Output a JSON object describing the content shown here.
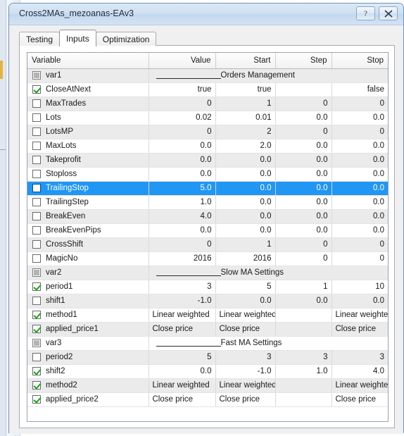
{
  "window": {
    "title": "Cross2MAs_mezoanas-EAv3",
    "help_button": "?",
    "close_button": "✕"
  },
  "tabs": [
    {
      "label": "Testing",
      "active": false
    },
    {
      "label": "Inputs",
      "active": true
    },
    {
      "label": "Optimization",
      "active": false
    }
  ],
  "grid": {
    "columns": [
      "Variable",
      "Value",
      "Start",
      "Step",
      "Stop"
    ],
    "rows": [
      {
        "type": "separator",
        "variable": "var1",
        "checkbox": "gray",
        "label": "Orders Management",
        "shade": "alt"
      },
      {
        "type": "data",
        "variable": "CloseAtNext",
        "checkbox": "checked",
        "value": "true",
        "start": "true",
        "step": "",
        "stop": "false",
        "shade": "norm"
      },
      {
        "type": "data",
        "variable": "MaxTrades",
        "checkbox": "unchecked",
        "value": "0",
        "start": "1",
        "step": "0",
        "stop": "0",
        "shade": "alt"
      },
      {
        "type": "data",
        "variable": "Lots",
        "checkbox": "unchecked",
        "value": "0.02",
        "start": "0.01",
        "step": "0.0",
        "stop": "0.0",
        "shade": "norm"
      },
      {
        "type": "data",
        "variable": "LotsMP",
        "checkbox": "unchecked",
        "value": "0",
        "start": "2",
        "step": "0",
        "stop": "0",
        "shade": "alt"
      },
      {
        "type": "data",
        "variable": "MaxLots",
        "checkbox": "unchecked",
        "value": "0.0",
        "start": "2.0",
        "step": "0.0",
        "stop": "0.0",
        "shade": "norm"
      },
      {
        "type": "data",
        "variable": "Takeprofit",
        "checkbox": "unchecked",
        "value": "0.0",
        "start": "0.0",
        "step": "0.0",
        "stop": "0.0",
        "shade": "alt"
      },
      {
        "type": "data",
        "variable": "Stoploss",
        "checkbox": "unchecked",
        "value": "0.0",
        "start": "0.0",
        "step": "0.0",
        "stop": "0.0",
        "shade": "norm"
      },
      {
        "type": "data",
        "variable": "TrailingStop",
        "checkbox": "unchecked",
        "value": "5.0",
        "start": "0.0",
        "step": "0.0",
        "stop": "0.0",
        "shade": "alt",
        "selected": true
      },
      {
        "type": "data",
        "variable": "TrailingStep",
        "checkbox": "unchecked",
        "value": "1.0",
        "start": "0.0",
        "step": "0.0",
        "stop": "0.0",
        "shade": "norm"
      },
      {
        "type": "data",
        "variable": "BreakEven",
        "checkbox": "unchecked",
        "value": "4.0",
        "start": "0.0",
        "step": "0.0",
        "stop": "0.0",
        "shade": "alt"
      },
      {
        "type": "data",
        "variable": "BreakEvenPips",
        "checkbox": "unchecked",
        "value": "0.0",
        "start": "0.0",
        "step": "0.0",
        "stop": "0.0",
        "shade": "norm"
      },
      {
        "type": "data",
        "variable": "CrossShift",
        "checkbox": "unchecked",
        "value": "0",
        "start": "1",
        "step": "0",
        "stop": "0",
        "shade": "alt"
      },
      {
        "type": "data",
        "variable": "MagicNo",
        "checkbox": "unchecked",
        "value": "2016",
        "start": "2016",
        "step": "0",
        "stop": "0",
        "shade": "norm"
      },
      {
        "type": "separator",
        "variable": "var2",
        "checkbox": "gray",
        "label": "Slow MA Settings",
        "shade": "alt"
      },
      {
        "type": "data",
        "variable": "period1",
        "checkbox": "checked",
        "value": "3",
        "start": "5",
        "step": "1",
        "stop": "10",
        "shade": "norm"
      },
      {
        "type": "data",
        "variable": "shift1",
        "checkbox": "unchecked",
        "value": "-1.0",
        "start": "0.0",
        "step": "0.0",
        "stop": "0.0",
        "shade": "alt"
      },
      {
        "type": "data",
        "variable": "method1",
        "checkbox": "checked",
        "value": "Linear weighted",
        "start": "Linear weighted",
        "step": "",
        "stop": "Linear weighted",
        "shade": "norm",
        "align": "txt"
      },
      {
        "type": "data",
        "variable": "applied_price1",
        "checkbox": "checked",
        "value": "Close price",
        "start": "Close price",
        "step": "",
        "stop": "Close price",
        "shade": "alt",
        "align": "txt"
      },
      {
        "type": "separator",
        "variable": "var3",
        "checkbox": "gray",
        "label": "Fast MA Settings",
        "shade": "norm"
      },
      {
        "type": "data",
        "variable": "period2",
        "checkbox": "unchecked",
        "value": "5",
        "start": "3",
        "step": "3",
        "stop": "3",
        "shade": "alt"
      },
      {
        "type": "data",
        "variable": "shift2",
        "checkbox": "checked",
        "value": "0.0",
        "start": "-1.0",
        "step": "1.0",
        "stop": "4.0",
        "shade": "norm"
      },
      {
        "type": "data",
        "variable": "method2",
        "checkbox": "checked",
        "value": "Linear weighted",
        "start": "Linear weighted",
        "step": "",
        "stop": "Linear weighted",
        "shade": "alt",
        "align": "txt"
      },
      {
        "type": "data",
        "variable": "applied_price2",
        "checkbox": "checked",
        "value": "Close price",
        "start": "Close price",
        "step": "",
        "stop": "Close price",
        "shade": "norm",
        "align": "txt"
      }
    ]
  },
  "colors": {
    "selection": "#2196f3",
    "checkmark": "#19a319",
    "titlebar": "#cfe0f2",
    "alt_row": "#ebebeb"
  }
}
